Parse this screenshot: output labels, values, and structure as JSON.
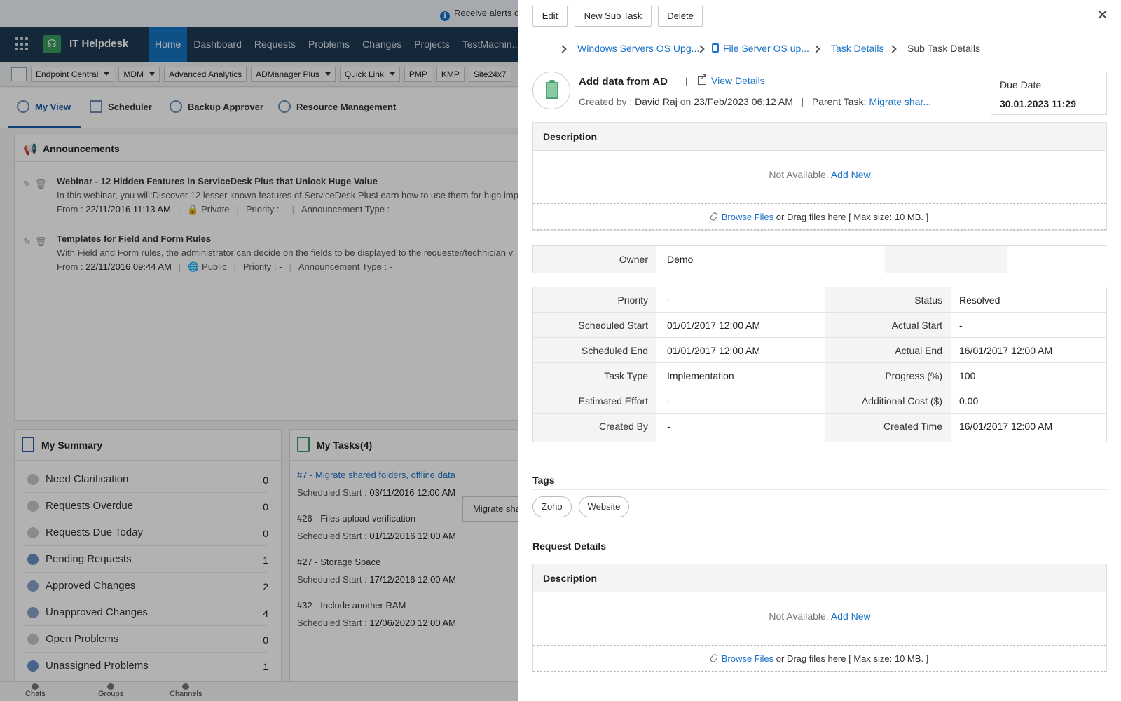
{
  "alert": {
    "text": "Receive alerts o"
  },
  "app": {
    "name": "IT Helpdesk"
  },
  "nav": {
    "items": [
      "Home",
      "Dashboard",
      "Requests",
      "Problems",
      "Changes",
      "Projects",
      "TestMachin..."
    ],
    "active": "Home"
  },
  "toolbar": {
    "buttons": [
      "Endpoint Central",
      "MDM",
      "Advanced Analytics",
      "ADManager Plus",
      "Quick Link",
      "PMP",
      "KMP",
      "Site24x7"
    ]
  },
  "view_tabs": [
    "My View",
    "Scheduler",
    "Backup Approver",
    "Resource Management"
  ],
  "announcements": {
    "title": "Announcements",
    "items": [
      {
        "title": "Webinar - 12 Hidden Features in ServiceDesk Plus that Unlock Huge Value",
        "body": "In this webinar, you will:Discover 12 lesser known features of ServiceDesk PlusLearn how to use them for high imp",
        "from_label": "From :",
        "from": "22/11/2016 11:13 AM",
        "visibility": "Private",
        "priority_label": "Priority :",
        "priority": "-",
        "type_label": "Announcement Type :",
        "type": "-"
      },
      {
        "title": "Templates for Field and Form Rules",
        "body": "With Field and Form rules, the administrator can decide on the fields to be displayed to the requester/technician v",
        "from_label": "From :",
        "from": "22/11/2016 09:44 AM",
        "visibility": "Public",
        "priority_label": "Priority :",
        "priority": "-",
        "type_label": "Announcement Type :",
        "type": "-"
      }
    ]
  },
  "summary": {
    "title": "My Summary",
    "rows": [
      {
        "label": "Need Clarification",
        "count": "0"
      },
      {
        "label": "Requests Overdue",
        "count": "0"
      },
      {
        "label": "Requests Due Today",
        "count": "0"
      },
      {
        "label": "Pending Requests",
        "count": "1"
      },
      {
        "label": "Approved Changes",
        "count": "2"
      },
      {
        "label": "Unapproved Changes",
        "count": "4"
      },
      {
        "label": "Open Problems",
        "count": "0"
      },
      {
        "label": "Unassigned Problems",
        "count": "1"
      }
    ]
  },
  "tasks": {
    "title": "My Tasks(4)",
    "start_label": "Scheduled Start :",
    "items": [
      {
        "title": "#7 - Migrate shared folders, offline data",
        "start": "03/11/2016 12:00 AM"
      },
      {
        "title": "#26 - Files upload verification",
        "start": "01/12/2016 12:00 AM"
      },
      {
        "title": "#27 - Storage Space",
        "start": "17/12/2016 12:00 AM"
      },
      {
        "title": "#32 - Include another RAM",
        "start": "12/06/2020 12:00 AM"
      }
    ],
    "tooltip": "Migrate sha"
  },
  "bottombar": [
    "Chats",
    "Groups",
    "Channels"
  ],
  "detail": {
    "buttons": {
      "edit": "Edit",
      "new_sub": "New Sub Task",
      "delete": "Delete"
    },
    "breadcrumb": [
      "Windows Servers OS Upg...",
      "File Server OS up...",
      "Task Details",
      "Sub Task Details"
    ],
    "task_name": "Add data from AD",
    "view_details": "View Details",
    "created_by_label": "Created by :",
    "created_by": "David Raj",
    "on_label": "on",
    "created_on": "23/Feb/2023 06:12 AM",
    "parent_label": "Parent Task:",
    "parent_task": "Migrate shar...",
    "due_label": "Due Date",
    "due_value": "30.01.2023 11:29",
    "description": {
      "title": "Description",
      "empty": "Not Available.",
      "add_new": "Add New",
      "browse": "Browse Files",
      "drag": "or Drag files here [ Max size: 10 MB. ]"
    },
    "owner_label": "Owner",
    "owner_value": "Demo",
    "fields": [
      {
        "k1": "Priority",
        "v1": "-",
        "k2": "Status",
        "v2": "Resolved"
      },
      {
        "k1": "Scheduled Start",
        "v1": "01/01/2017 12:00 AM",
        "k2": "Actual Start",
        "v2": "-"
      },
      {
        "k1": "Scheduled End",
        "v1": "01/01/2017 12:00 AM",
        "k2": "Actual End",
        "v2": "16/01/2017 12:00 AM"
      },
      {
        "k1": "Task Type",
        "v1": "Implementation",
        "k2": "Progress (%)",
        "v2": "100"
      },
      {
        "k1": "Estimated Effort",
        "v1": "-",
        "k2": "Additional Cost ($)",
        "v2": "0.00"
      },
      {
        "k1": "Created By",
        "v1": "-",
        "k2": "Created Time",
        "v2": "16/01/2017 12:00 AM"
      }
    ],
    "tags_title": "Tags",
    "tags": [
      "Zoho",
      "Website"
    ],
    "request_details_title": "Request Details",
    "request_description": {
      "title": "Description",
      "empty": "Not Available.",
      "add_new": "Add New",
      "browse": "Browse Files",
      "drag": "or Drag files here [ Max size: 10 MB. ]"
    }
  }
}
